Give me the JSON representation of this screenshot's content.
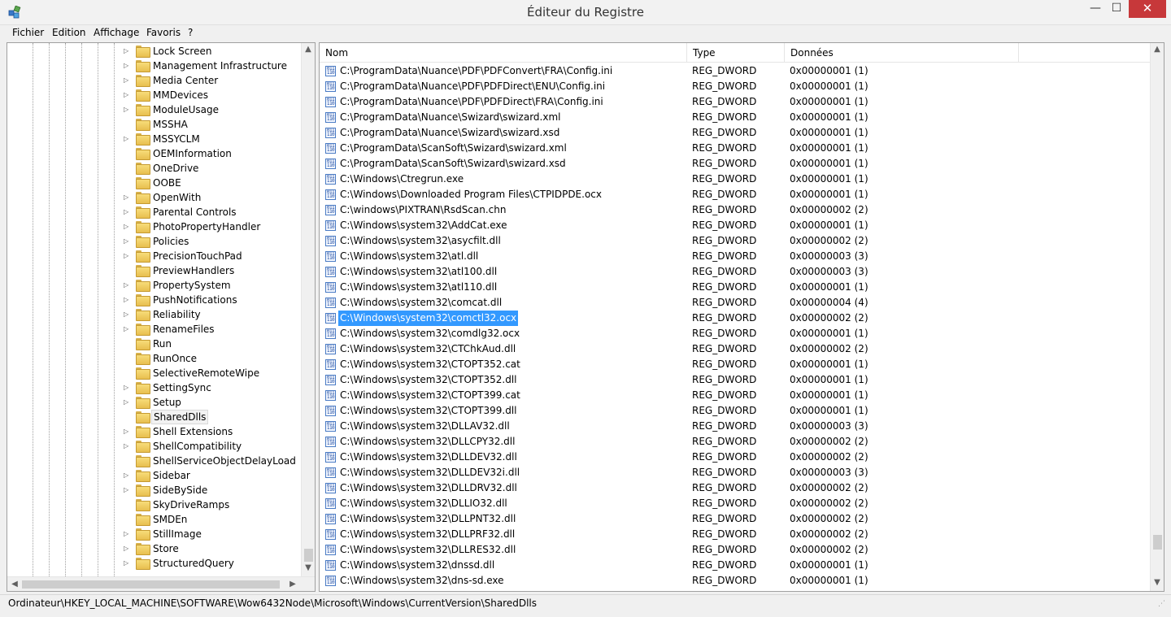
{
  "window": {
    "title": "Éditeur du Registre",
    "minimize_glyph": "—",
    "maximize_glyph": "☐",
    "close_glyph": "✕",
    "app_icon": "registry-editor-icon",
    "accent_close": "#c7383a"
  },
  "menu": [
    "Fichier",
    "Edition",
    "Affichage",
    "Favoris",
    "?"
  ],
  "tree": {
    "items": [
      {
        "label": "Lock Screen",
        "expandable": true
      },
      {
        "label": "Management Infrastructure",
        "expandable": true
      },
      {
        "label": "Media Center",
        "expandable": true
      },
      {
        "label": "MMDevices",
        "expandable": true
      },
      {
        "label": "ModuleUsage",
        "expandable": true
      },
      {
        "label": "MSSHA",
        "expandable": false
      },
      {
        "label": "MSSYCLM",
        "expandable": true
      },
      {
        "label": "OEMInformation",
        "expandable": false
      },
      {
        "label": "OneDrive",
        "expandable": false
      },
      {
        "label": "OOBE",
        "expandable": false
      },
      {
        "label": "OpenWith",
        "expandable": true
      },
      {
        "label": "Parental Controls",
        "expandable": true
      },
      {
        "label": "PhotoPropertyHandler",
        "expandable": true
      },
      {
        "label": "Policies",
        "expandable": true
      },
      {
        "label": "PrecisionTouchPad",
        "expandable": true
      },
      {
        "label": "PreviewHandlers",
        "expandable": false
      },
      {
        "label": "PropertySystem",
        "expandable": true
      },
      {
        "label": "PushNotifications",
        "expandable": true
      },
      {
        "label": "Reliability",
        "expandable": true
      },
      {
        "label": "RenameFiles",
        "expandable": true
      },
      {
        "label": "Run",
        "expandable": false
      },
      {
        "label": "RunOnce",
        "expandable": false
      },
      {
        "label": "SelectiveRemoteWipe",
        "expandable": false
      },
      {
        "label": "SettingSync",
        "expandable": true
      },
      {
        "label": "Setup",
        "expandable": true
      },
      {
        "label": "SharedDlls",
        "expandable": false,
        "selected": true
      },
      {
        "label": "Shell Extensions",
        "expandable": true
      },
      {
        "label": "ShellCompatibility",
        "expandable": true
      },
      {
        "label": "ShellServiceObjectDelayLoad",
        "expandable": false
      },
      {
        "label": "Sidebar",
        "expandable": true
      },
      {
        "label": "SideBySide",
        "expandable": true
      },
      {
        "label": "SkyDriveRamps",
        "expandable": false
      },
      {
        "label": "SMDEn",
        "expandable": false
      },
      {
        "label": "StillImage",
        "expandable": true
      },
      {
        "label": "Store",
        "expandable": true
      },
      {
        "label": "StructuredQuery",
        "expandable": true
      }
    ]
  },
  "list": {
    "columns": [
      "Nom",
      "Type",
      "Données"
    ],
    "selected_index": 16,
    "rows": [
      [
        "C:\\ProgramData\\Nuance\\PDF\\PDFConvert\\FRA\\Config.ini",
        "REG_DWORD",
        "0x00000001 (1)"
      ],
      [
        "C:\\ProgramData\\Nuance\\PDF\\PDFDirect\\ENU\\Config.ini",
        "REG_DWORD",
        "0x00000001 (1)"
      ],
      [
        "C:\\ProgramData\\Nuance\\PDF\\PDFDirect\\FRA\\Config.ini",
        "REG_DWORD",
        "0x00000001 (1)"
      ],
      [
        "C:\\ProgramData\\Nuance\\Swizard\\swizard.xml",
        "REG_DWORD",
        "0x00000001 (1)"
      ],
      [
        "C:\\ProgramData\\Nuance\\Swizard\\swizard.xsd",
        "REG_DWORD",
        "0x00000001 (1)"
      ],
      [
        "C:\\ProgramData\\ScanSoft\\Swizard\\swizard.xml",
        "REG_DWORD",
        "0x00000001 (1)"
      ],
      [
        "C:\\ProgramData\\ScanSoft\\Swizard\\swizard.xsd",
        "REG_DWORD",
        "0x00000001 (1)"
      ],
      [
        "C:\\Windows\\Ctregrun.exe",
        "REG_DWORD",
        "0x00000001 (1)"
      ],
      [
        "C:\\Windows\\Downloaded Program Files\\CTPIDPDE.ocx",
        "REG_DWORD",
        "0x00000001 (1)"
      ],
      [
        "C:\\windows\\PIXTRAN\\RsdScan.chn",
        "REG_DWORD",
        "0x00000002 (2)"
      ],
      [
        "C:\\Windows\\system32\\AddCat.exe",
        "REG_DWORD",
        "0x00000001 (1)"
      ],
      [
        "C:\\Windows\\system32\\asycfilt.dll",
        "REG_DWORD",
        "0x00000002 (2)"
      ],
      [
        "C:\\Windows\\system32\\atl.dll",
        "REG_DWORD",
        "0x00000003 (3)"
      ],
      [
        "C:\\Windows\\system32\\atl100.dll",
        "REG_DWORD",
        "0x00000003 (3)"
      ],
      [
        "C:\\Windows\\system32\\atl110.dll",
        "REG_DWORD",
        "0x00000001 (1)"
      ],
      [
        "C:\\Windows\\system32\\comcat.dll",
        "REG_DWORD",
        "0x00000004 (4)"
      ],
      [
        "C:\\Windows\\system32\\comctl32.ocx",
        "REG_DWORD",
        "0x00000002 (2)"
      ],
      [
        "C:\\Windows\\system32\\comdlg32.ocx",
        "REG_DWORD",
        "0x00000001 (1)"
      ],
      [
        "C:\\Windows\\system32\\CTChkAud.dll",
        "REG_DWORD",
        "0x00000002 (2)"
      ],
      [
        "C:\\Windows\\system32\\CTOPT352.cat",
        "REG_DWORD",
        "0x00000001 (1)"
      ],
      [
        "C:\\Windows\\system32\\CTOPT352.dll",
        "REG_DWORD",
        "0x00000001 (1)"
      ],
      [
        "C:\\Windows\\system32\\CTOPT399.cat",
        "REG_DWORD",
        "0x00000001 (1)"
      ],
      [
        "C:\\Windows\\system32\\CTOPT399.dll",
        "REG_DWORD",
        "0x00000001 (1)"
      ],
      [
        "C:\\Windows\\system32\\DLLAV32.dll",
        "REG_DWORD",
        "0x00000003 (3)"
      ],
      [
        "C:\\Windows\\system32\\DLLCPY32.dll",
        "REG_DWORD",
        "0x00000002 (2)"
      ],
      [
        "C:\\Windows\\system32\\DLLDEV32.dll",
        "REG_DWORD",
        "0x00000002 (2)"
      ],
      [
        "C:\\Windows\\system32\\DLLDEV32i.dll",
        "REG_DWORD",
        "0x00000003 (3)"
      ],
      [
        "C:\\Windows\\system32\\DLLDRV32.dll",
        "REG_DWORD",
        "0x00000002 (2)"
      ],
      [
        "C:\\Windows\\system32\\DLLIO32.dll",
        "REG_DWORD",
        "0x00000002 (2)"
      ],
      [
        "C:\\Windows\\system32\\DLLPNT32.dll",
        "REG_DWORD",
        "0x00000002 (2)"
      ],
      [
        "C:\\Windows\\system32\\DLLPRF32.dll",
        "REG_DWORD",
        "0x00000002 (2)"
      ],
      [
        "C:\\Windows\\system32\\DLLRES32.dll",
        "REG_DWORD",
        "0x00000002 (2)"
      ],
      [
        "C:\\Windows\\system32\\dnssd.dll",
        "REG_DWORD",
        "0x00000001 (1)"
      ],
      [
        "C:\\Windows\\system32\\dns-sd.exe",
        "REG_DWORD",
        "0x00000001 (1)"
      ]
    ],
    "row_icon": "reg-binary-value-icon",
    "icon_glyph": "011 110",
    "selection_color": "#3399ff"
  },
  "status": {
    "path": "Ordinateur\\HKEY_LOCAL_MACHINE\\SOFTWARE\\Wow6432Node\\Microsoft\\Windows\\CurrentVersion\\SharedDlls"
  }
}
